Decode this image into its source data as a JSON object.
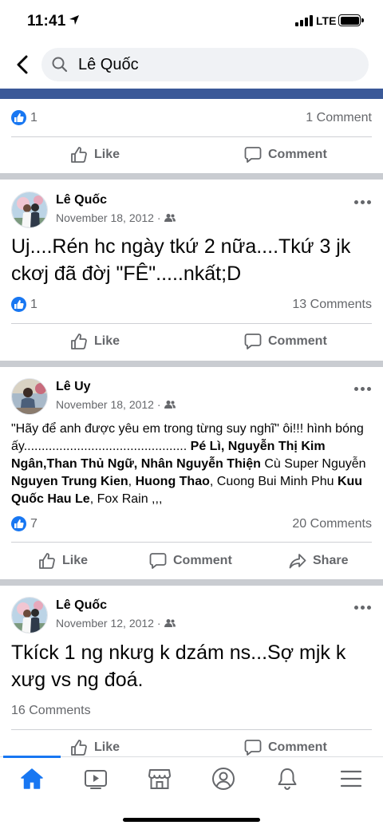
{
  "status_bar": {
    "time": "11:41",
    "network": "LTE"
  },
  "search": {
    "query": "Lê Quốc"
  },
  "first_post_footer": {
    "like_count": "1",
    "comments": "1 Comment",
    "like_label": "Like",
    "comment_label": "Comment"
  },
  "posts": [
    {
      "author": "Lê Quốc",
      "date": "November 18, 2012 ·",
      "text": "Uj....Rén hc ngày tkứ 2 nữa....Tkứ 3 jk ckơj đã đờj \"FÊ\".....nkất;D",
      "like_count": "1",
      "comments": "13 Comments",
      "like_label": "Like",
      "comment_label": "Comment"
    },
    {
      "author": "Lê Uy",
      "date": "November 18, 2012 ·",
      "text_parts": [
        "\"Hãy để anh được yêu em trong từng suy nghĩ\" ôi!!! hình bóng ấy.............................................. ",
        "Pé Lì",
        ", ",
        "Nguyễn Thị Kim Ngân",
        ",",
        "Than Thủ Ngữ",
        ", ",
        "Nhân Nguyễn Thiện",
        " Cù Super Nguyễn ",
        "Nguyen Trung Kien",
        ", ",
        "Huong Thao",
        ", Cuong Bui Minh Phu ",
        "Kuu Quốc Hau Le",
        ", Fox Rain ,,,"
      ],
      "like_count": "7",
      "comments": "20 Comments",
      "like_label": "Like",
      "comment_label": "Comment",
      "share_label": "Share"
    },
    {
      "author": "Lê Quốc",
      "date": "November 12, 2012 ·",
      "text": "Tkíck 1 ng nkưg k dzám ns...Sợ mjk k xưg vs ng đoá.",
      "comments": "16 Comments",
      "like_label": "Like",
      "comment_label": "Comment"
    }
  ],
  "tabbar": {
    "items": [
      "home-icon",
      "video-icon",
      "marketplace-icon",
      "profile-icon",
      "notifications-icon",
      "menu-icon"
    ],
    "active_color": "#1877f2"
  },
  "colors": {
    "accent": "#1877f2",
    "band": "#3b5998",
    "muted": "#65676b"
  }
}
